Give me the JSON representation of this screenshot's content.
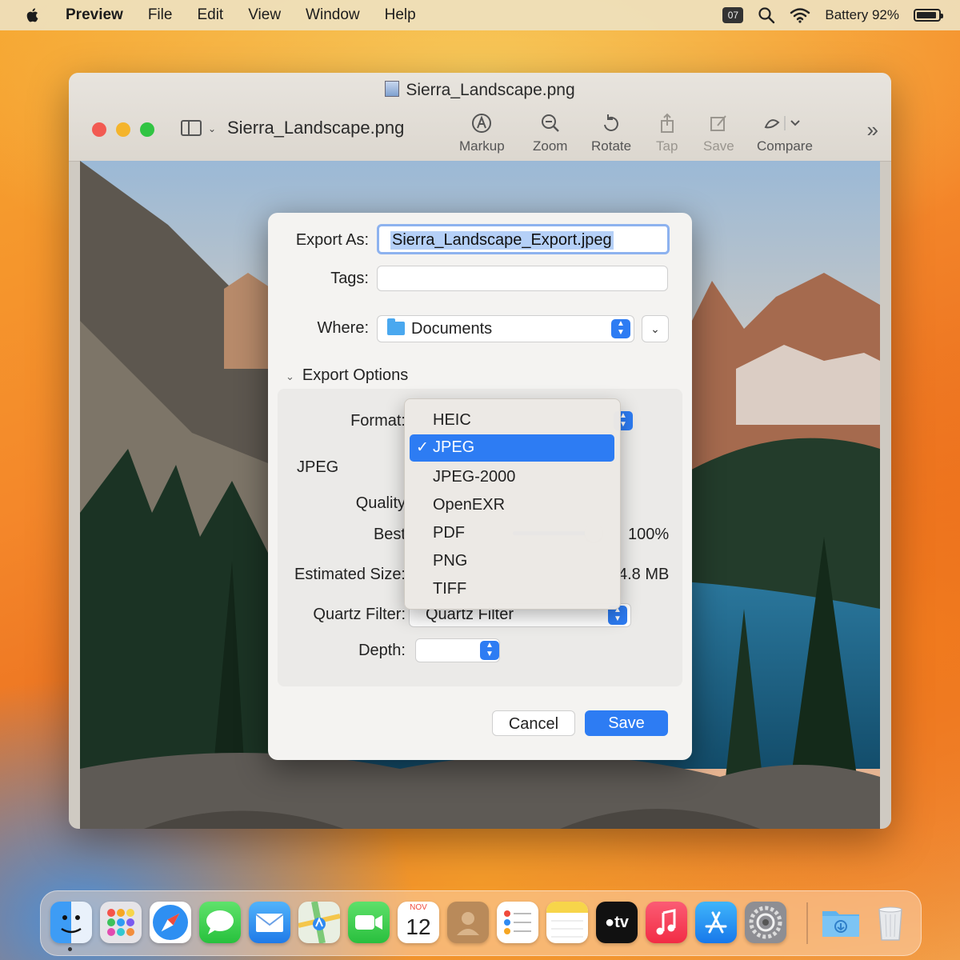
{
  "menubar": {
    "app_name": "Preview",
    "items": [
      "File",
      "Edit",
      "View",
      "Window",
      "Help"
    ],
    "badge": "07",
    "battery": "Battery 92%"
  },
  "window": {
    "title": "Sierra_Landscape.png",
    "file_name": "Sierra_Landscape.png",
    "tools": {
      "markup": "Markup",
      "zoom": "Zoom",
      "rotate": "Rotate",
      "tap": "Tap",
      "save": "Save",
      "compare": "Compare"
    }
  },
  "dialog": {
    "export_as_label": "Export As:",
    "export_as_value": "Sierra_Landscape_Export.jpeg",
    "tags_label": "Tags:",
    "where_label": "Where:",
    "where_value": "Documents",
    "export_options": "Export Options",
    "format_label": "Format:",
    "jpeg_label": "JPEG",
    "quality_label": "Quality",
    "best_label": "Best",
    "quality_value": "100%",
    "estimated_size_label": "Estimated Size:",
    "estimated_size_value": "4.8 MB",
    "quartz_label": "Quartz Filter:",
    "quartz_value": "Quartz Filter",
    "depth_label": "Depth:",
    "cancel": "Cancel",
    "save": "Save"
  },
  "format_menu": {
    "options": [
      "HEIC",
      "JPEG",
      "JPEG-2000",
      "OpenEXR",
      "PDF",
      "PNG",
      "TIFF"
    ],
    "selected": "JPEG"
  },
  "dock": {
    "calendar_month": "NOV",
    "calendar_day": "12",
    "tv_label": "tv"
  },
  "colors": {
    "accent": "#2d7cf3",
    "close": "#f25a52",
    "minimize": "#f4b42c",
    "zoom": "#31c443"
  }
}
